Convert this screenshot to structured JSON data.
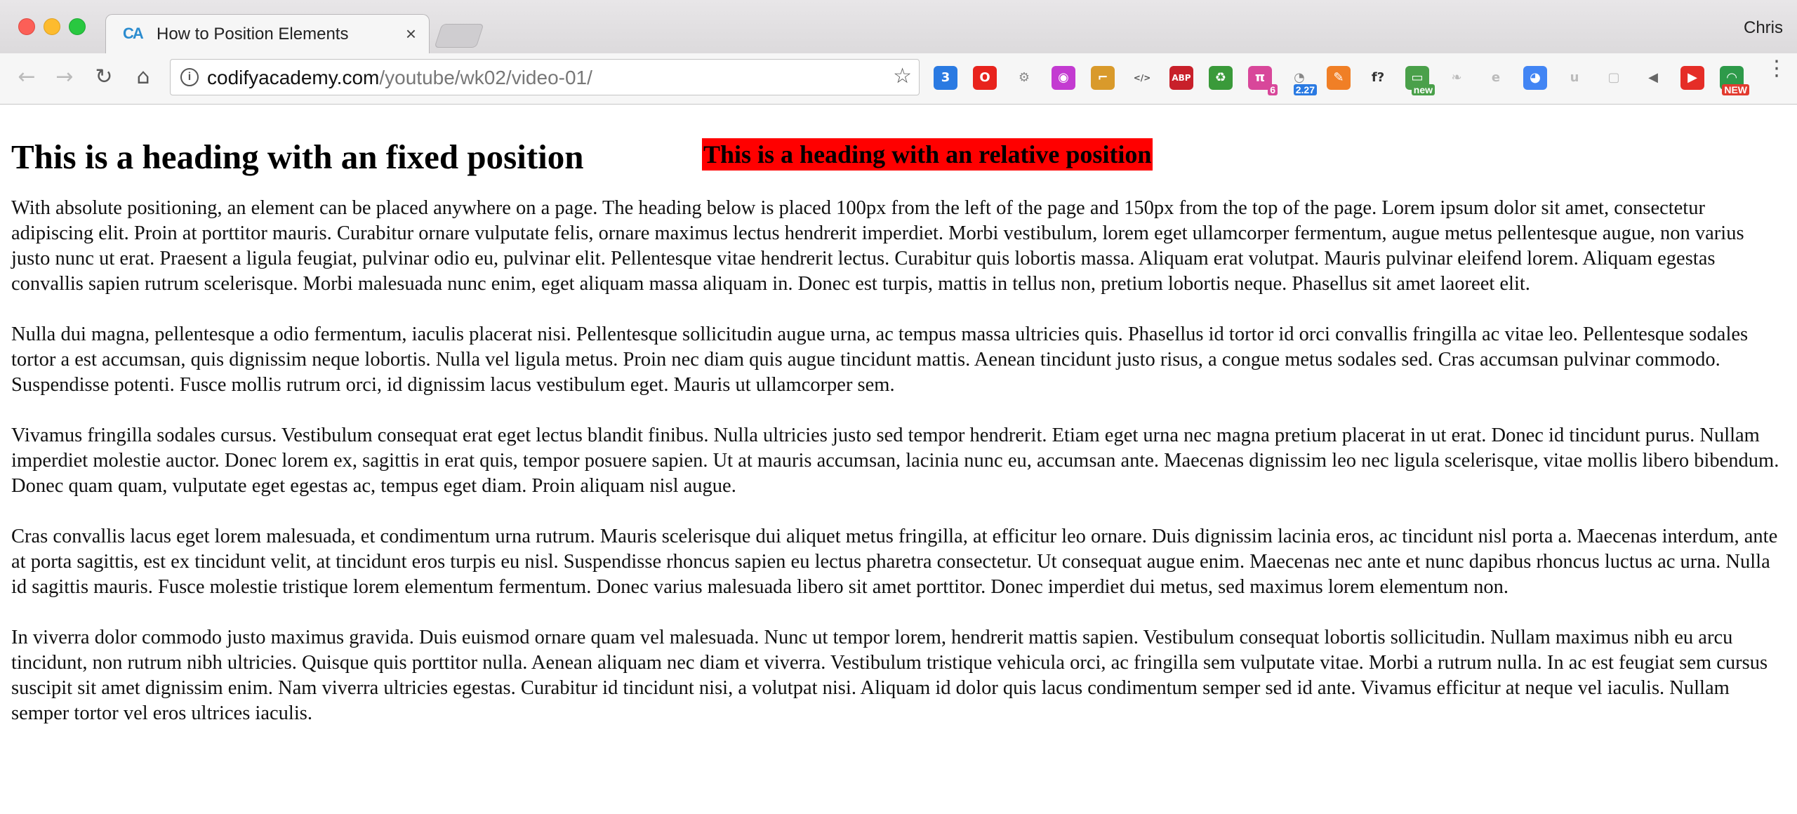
{
  "browser": {
    "tab": {
      "favicon_text": "CA",
      "title": "How to Position Elements",
      "close_glyph": "×"
    },
    "profile_name": "Chris",
    "nav": {
      "back_icon": "arrow-left-icon",
      "forward_icon": "arrow-right-icon",
      "reload_icon": "reload-icon",
      "home_icon": "home-icon"
    },
    "address": {
      "host": "codifyacademy.com",
      "path": "/youtube/wk02/video-01/"
    },
    "extensions": [
      {
        "name": "css3-icon",
        "glyph": "3",
        "color": "#2a7ae2"
      },
      {
        "name": "opera-icon",
        "glyph": "O",
        "color": "#e8231d"
      },
      {
        "name": "settings-icon",
        "glyph": "⚙",
        "color": "#888888"
      },
      {
        "name": "color-wheel-icon",
        "glyph": "◉",
        "color": "#c33bd1"
      },
      {
        "name": "ruler-icon",
        "glyph": "⌐",
        "color": "#d99a2b"
      },
      {
        "name": "code-icon",
        "glyph": "</>",
        "color": "#555555"
      },
      {
        "name": "adblock-icon",
        "glyph": "ABP",
        "color": "#c8202a"
      },
      {
        "name": "recycle-icon",
        "glyph": "♻",
        "color": "#3a9a3a"
      },
      {
        "name": "pattern-icon",
        "glyph": "π",
        "color": "#d8479a",
        "badge": "6"
      },
      {
        "name": "speed-icon",
        "glyph": "◔",
        "color": "#888888",
        "badge": "2.27"
      },
      {
        "name": "tool-icon",
        "glyph": "✎",
        "color": "#f07f26"
      },
      {
        "name": "font-icon",
        "glyph": "f?",
        "color": "#333333"
      },
      {
        "name": "window-icon",
        "glyph": "▭",
        "color": "#4aa04a",
        "badge": "new"
      },
      {
        "name": "leaf-icon",
        "glyph": "❧",
        "color": "#bbbbbb"
      },
      {
        "name": "pocket-icon",
        "glyph": "e",
        "color": "#bbbbbb"
      },
      {
        "name": "chrome-icon",
        "glyph": "◕",
        "color": "#4285f4"
      },
      {
        "name": "ghost-icon",
        "glyph": "u",
        "color": "#bbbbbb"
      },
      {
        "name": "screen-icon",
        "glyph": "▢",
        "color": "#bbbbbb"
      },
      {
        "name": "speaker-icon",
        "glyph": "◀",
        "color": "#666666"
      },
      {
        "name": "youtube-icon",
        "glyph": "▶",
        "color": "#e52d27"
      },
      {
        "name": "update-icon",
        "glyph": "◠",
        "color": "#2e9a4a",
        "badge": "NEW"
      }
    ],
    "menu_icon": "more-vert-icon"
  },
  "page": {
    "heading_fixed": "This is a heading with an fixed position",
    "heading_relative": "This is a heading with an relative position",
    "paragraphs": [
      "With absolute positioning, an element can be placed anywhere on a page. The heading below is placed 100px from the left of the page and 150px from the top of the page. Lorem ipsum dolor sit amet, consectetur adipiscing elit. Proin at porttitor mauris. Curabitur ornare vulputate felis, ornare maximus lectus hendrerit imperdiet. Morbi vestibulum, lorem eget ullamcorper fermentum, augue metus pellentesque augue, non varius justo nunc ut erat. Praesent a ligula feugiat, pulvinar odio eu, pulvinar elit. Pellentesque vitae hendrerit lectus. Curabitur quis lobortis massa. Aliquam erat volutpat. Mauris pulvinar eleifend lorem. Aliquam egestas convallis sapien rutrum scelerisque. Morbi malesuada nunc enim, eget aliquam massa aliquam in. Donec est turpis, mattis in tellus non, pretium lobortis neque. Phasellus sit amet laoreet elit.",
      "Nulla dui magna, pellentesque a odio fermentum, iaculis placerat nisi. Pellentesque sollicitudin augue urna, ac tempus massa ultricies quis. Phasellus id tortor id orci convallis fringilla ac vitae leo. Pellentesque sodales tortor a est accumsan, quis dignissim neque lobortis. Nulla vel ligula metus. Proin nec diam quis augue tincidunt mattis. Aenean tincidunt justo risus, a congue metus sodales sed. Cras accumsan pulvinar commodo. Suspendisse potenti. Fusce mollis rutrum orci, id dignissim lacus vestibulum eget. Mauris ut ullamcorper sem.",
      "Vivamus fringilla sodales cursus. Vestibulum consequat erat eget lectus blandit finibus. Nulla ultricies justo sed tempor hendrerit. Etiam eget urna nec magna pretium placerat in ut erat. Donec id tincidunt purus. Nullam imperdiet molestie auctor. Donec lorem ex, sagittis in erat quis, tempor posuere sapien. Ut at mauris accumsan, lacinia nunc eu, accumsan ante. Maecenas dignissim leo nec ligula scelerisque, vitae mollis libero bibendum. Donec quam quam, vulputate eget egestas ac, tempus eget diam. Proin aliquam nisl augue.",
      "Cras convallis lacus eget lorem malesuada, et condimentum urna rutrum. Mauris scelerisque dui aliquet metus fringilla, at efficitur leo ornare. Duis dignissim lacinia eros, ac tincidunt nisl porta a. Maecenas interdum, ante at porta sagittis, est ex tincidunt velit, at tincidunt eros turpis eu nisl. Suspendisse rhoncus sapien eu lectus pharetra consectetur. Ut consequat augue enim. Maecenas nec ante et nunc dapibus rhoncus luctus ac urna. Nulla id sagittis mauris. Fusce molestie tristique lorem elementum fermentum. Donec varius malesuada libero sit amet porttitor. Donec imperdiet dui metus, sed maximus lorem elementum non.",
      "In viverra dolor commodo justo maximus gravida. Duis euismod ornare quam vel malesuada. Nunc ut tempor lorem, hendrerit mattis sapien. Vestibulum consequat lobortis sollicitudin. Nullam maximus nibh eu arcu tincidunt, non rutrum nibh ultricies. Quisque quis porttitor nulla. Aenean aliquam nec diam et viverra. Vestibulum tristique vehicula orci, ac fringilla sem vulputate vitae. Morbi a rutrum nulla. In ac est feugiat sem cursus suscipit sit amet dignissim enim. Nam viverra ultricies egestas. Curabitur id tincidunt nisi, a volutpat nisi. Aliquam id dolor quis lacus condimentum semper sed id ante. Vivamus efficitur at neque vel iaculis. Nullam semper tortor vel eros ultrices iaculis."
    ],
    "relative_heading_bg": "#ff0000"
  }
}
